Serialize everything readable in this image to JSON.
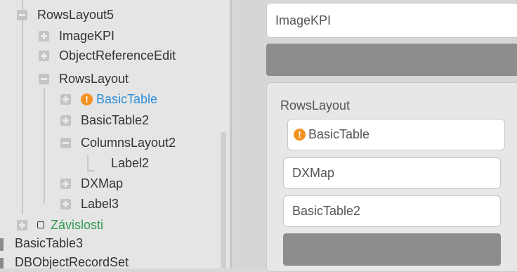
{
  "tree": {
    "items": [
      {
        "label": "RowsLayout5",
        "expander": "minus"
      },
      {
        "label": "ImageKPI",
        "expander": "plus"
      },
      {
        "label": "ObjectReferenceEdit",
        "expander": "plus"
      },
      {
        "label": "RowsLayout",
        "expander": "minus"
      },
      {
        "label": "BasicTable",
        "expander": "plus",
        "warning": "!"
      },
      {
        "label": "BasicTable2",
        "expander": "plus"
      },
      {
        "label": "ColumnsLayout2",
        "expander": "minus"
      },
      {
        "label": "Label2"
      },
      {
        "label": "DXMap",
        "expander": "plus"
      },
      {
        "label": "Label3",
        "expander": "plus"
      },
      {
        "label": "Závislosti",
        "expander": "plus"
      },
      {
        "label": "BasicTable3"
      },
      {
        "label": "DBObjectRecordSet"
      }
    ]
  },
  "designer": {
    "top_card": "ImageKPI",
    "group_title": "RowsLayout",
    "cards": [
      "BasicTable",
      "DXMap",
      "BasicTable2"
    ],
    "warning_glyph": "!"
  },
  "colors": {
    "warning": "#f39220",
    "warning_text": "#2f8fd8",
    "link_green": "#2f9a52"
  }
}
